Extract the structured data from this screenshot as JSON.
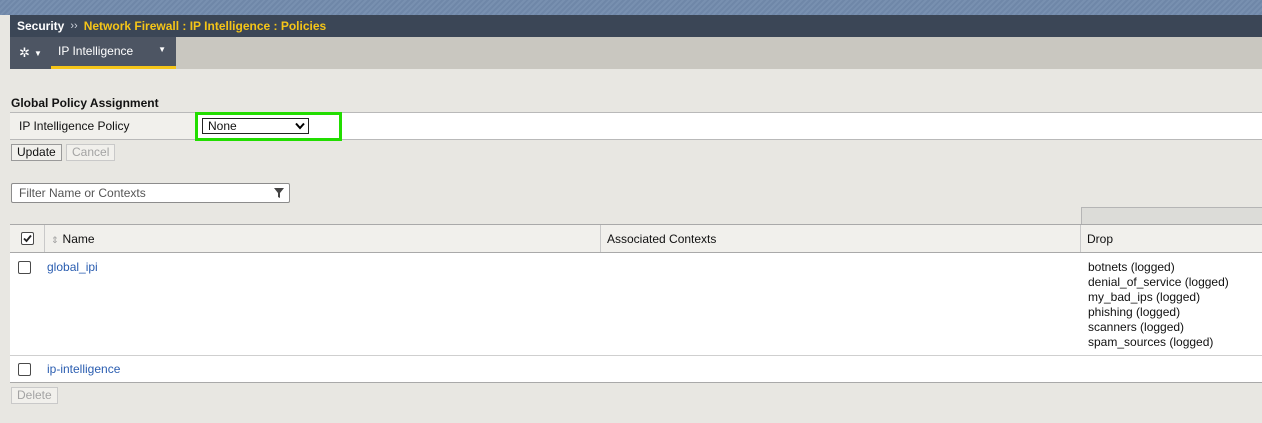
{
  "breadcrumb": {
    "root": "Security",
    "separator": "››",
    "path": "Network Firewall : IP Intelligence : Policies"
  },
  "tabs": {
    "active": "IP Intelligence"
  },
  "global_policy": {
    "section_title": "Global Policy Assignment",
    "label": "IP Intelligence Policy",
    "selected": "None",
    "update_label": "Update",
    "cancel_label": "Cancel"
  },
  "filter": {
    "placeholder": "Filter Name or Contexts"
  },
  "table": {
    "columns": {
      "name": "Name",
      "contexts": "Associated Contexts",
      "drop": "Drop"
    },
    "rows": [
      {
        "name": "global_ipi",
        "contexts": "",
        "drop": [
          "botnets (logged)",
          "denial_of_service (logged)",
          "my_bad_ips (logged)",
          "phishing (logged)",
          "scanners (logged)",
          "spam_sources (logged)"
        ]
      },
      {
        "name": "ip-intelligence",
        "contexts": "",
        "drop": []
      }
    ]
  },
  "actions": {
    "delete_label": "Delete"
  },
  "colors": {
    "accent": "#f5c518",
    "highlight": "#22dd00",
    "link": "#2a5db0",
    "header_bg": "#3b4656"
  },
  "icons": [
    "gear-icon",
    "chevron-down-icon",
    "funnel-icon",
    "sort-icon",
    "checkbox-icon"
  ]
}
